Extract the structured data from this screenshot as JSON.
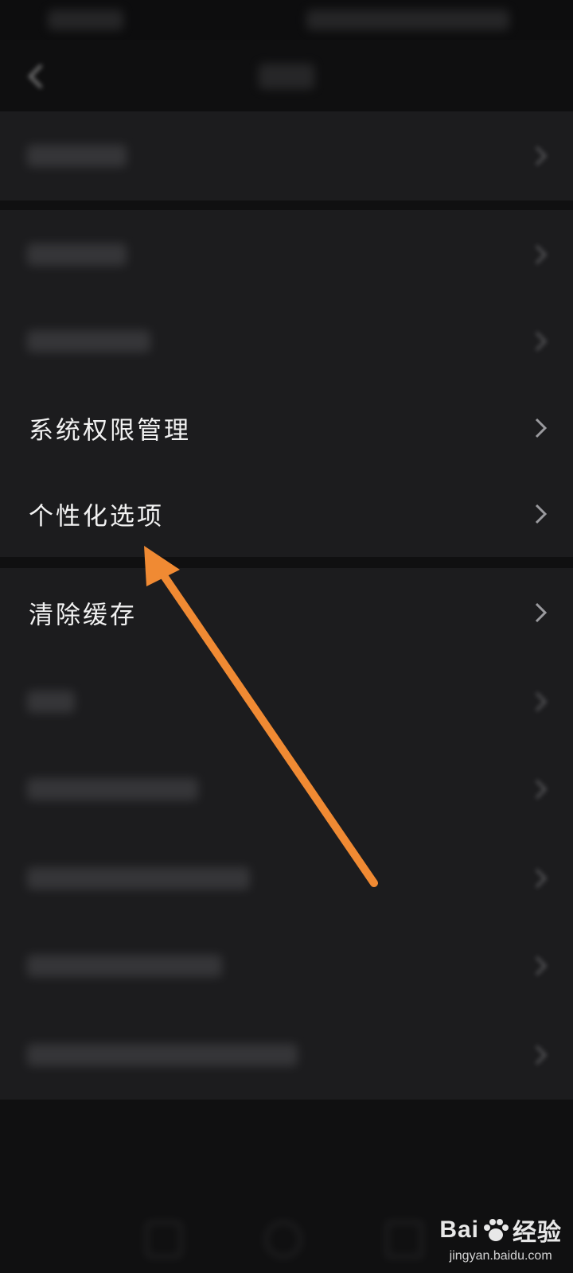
{
  "colors": {
    "background": "#101011",
    "row_background": "#1c1c1e",
    "text": "#f2f2f2",
    "chevron": "#9a9a9e",
    "annotation_arrow": "#f08a33"
  },
  "settings": {
    "visible_items": [
      {
        "label": "系统权限管理",
        "icon": "chevron-right-icon"
      },
      {
        "label": "个性化选项",
        "icon": "chevron-right-icon"
      },
      {
        "label": "清除缓存",
        "icon": "chevron-right-icon"
      }
    ]
  },
  "watermark": {
    "brand": "Bai",
    "brand_suffix": "经验",
    "url": "jingyan.baidu.com"
  },
  "annotation": {
    "type": "arrow",
    "icon": "arrow-annotation"
  }
}
